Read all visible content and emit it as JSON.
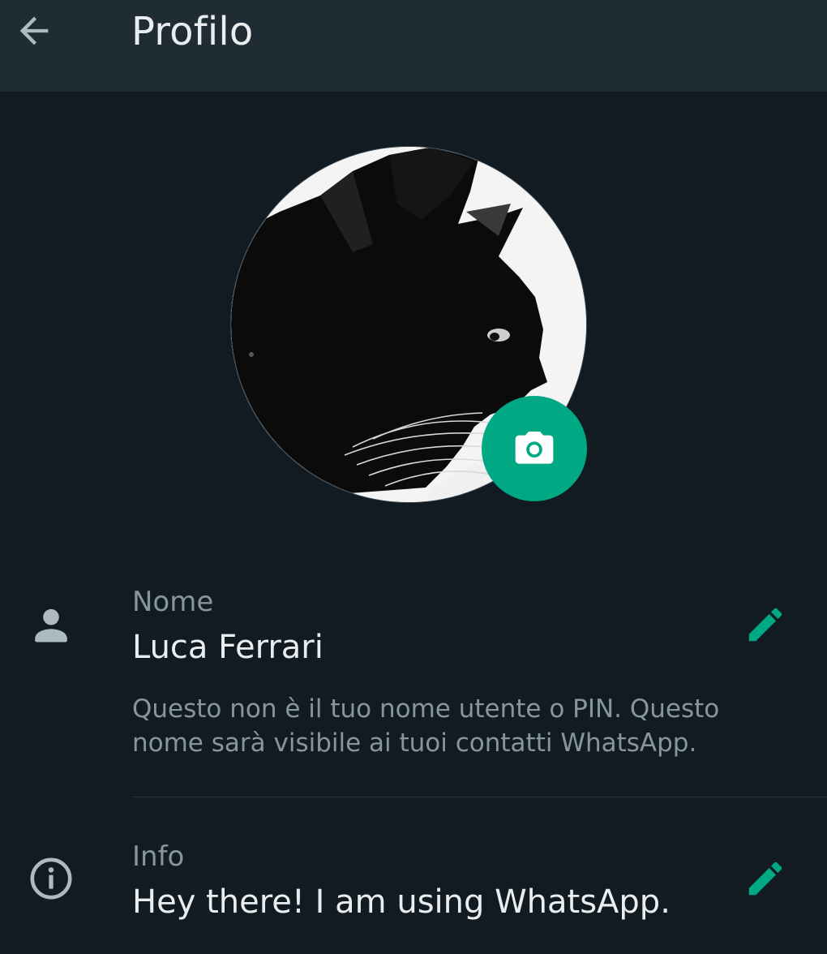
{
  "header": {
    "title": "Profilo",
    "back_icon": "arrow-back-icon"
  },
  "avatar": {
    "subject": "black cat profile photo",
    "camera_icon": "camera-icon"
  },
  "name_field": {
    "icon": "person-icon",
    "label": "Nome",
    "value": "Luca Ferrari",
    "hint": "Questo non è il tuo nome utente o PIN. Questo nome sarà visibile ai tuoi contatti WhatsApp.",
    "edit_icon": "pencil-icon"
  },
  "about_field": {
    "icon": "info-icon",
    "label": "Info",
    "value": "Hey there! I am using WhatsApp.",
    "edit_icon": "pencil-icon"
  },
  "colors": {
    "background": "#111b21",
    "header": "#202c33",
    "accent": "#00a884",
    "primary_text": "#e9edef",
    "secondary_text": "#8696a0",
    "icon_gray": "#aebac1"
  }
}
